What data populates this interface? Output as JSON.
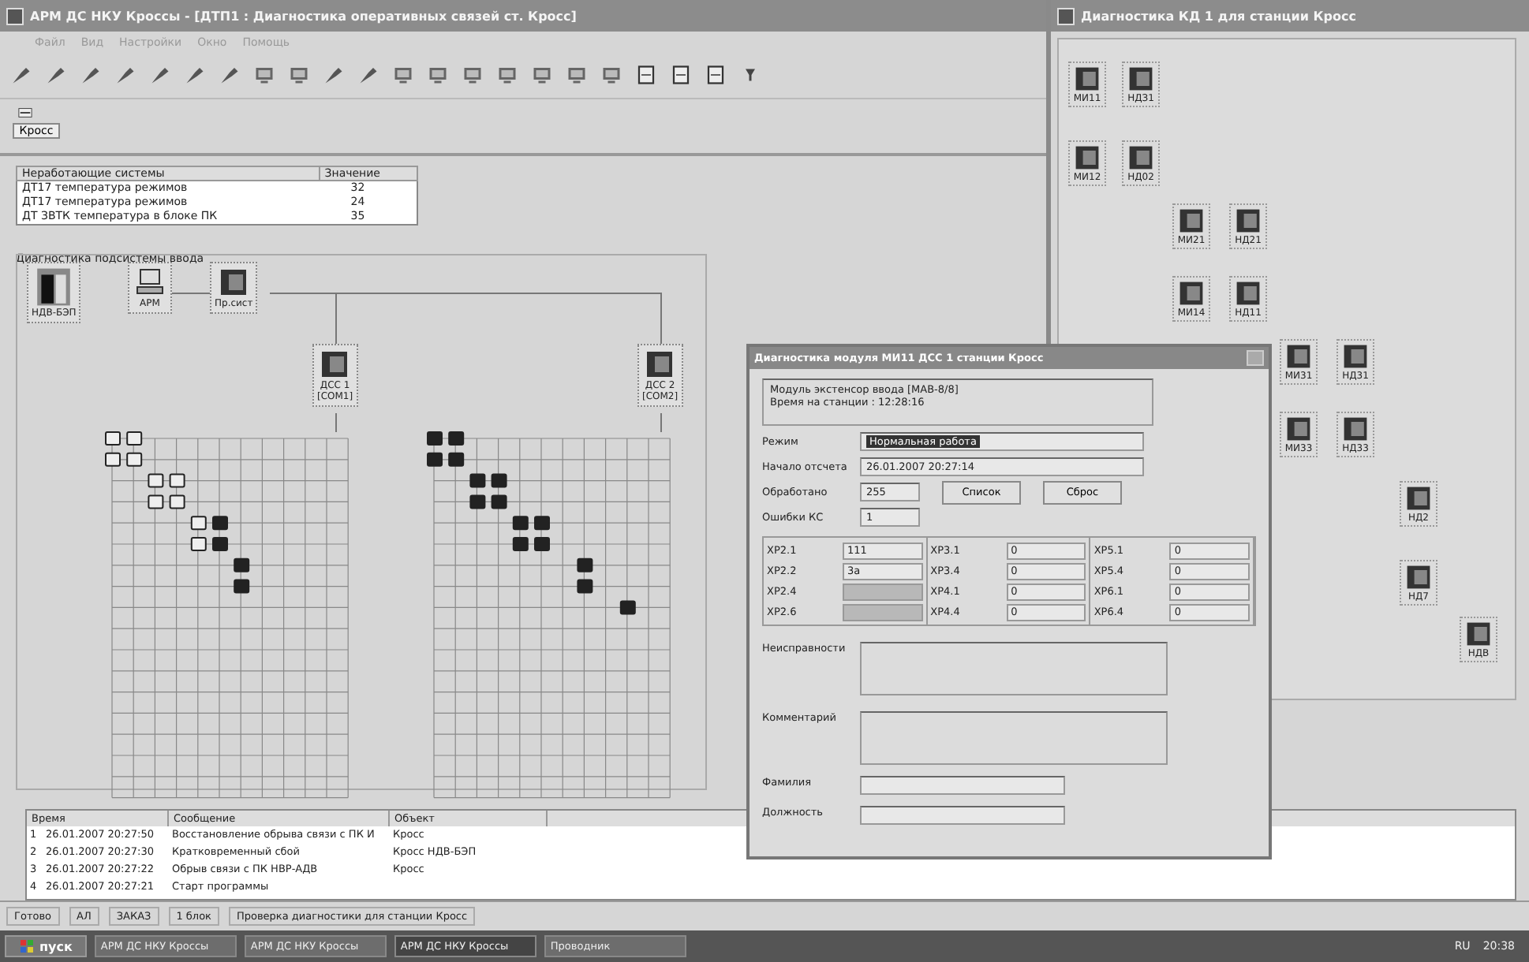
{
  "main_window": {
    "title": "АРМ ДС НКУ Кроссы - [ДТП1 : Диагностика оперативных связей ст. Кросс]"
  },
  "menu": [
    "Файл",
    "Вид",
    "Настройки",
    "Окно",
    "Помощь"
  ],
  "station_button": {
    "label": "Кросс"
  },
  "signals_table": {
    "columns": [
      "Неработающие системы",
      "Значение"
    ],
    "rows": [
      [
        "ДТ17 температура режимов",
        "32"
      ],
      [
        "ДТ17 температура режимов",
        "24"
      ],
      [
        "ДТ ЗВТК температура в блоке ПК",
        "35"
      ]
    ]
  },
  "diagram": {
    "title": "Диагностика подсистемы ввода",
    "nodes": [
      {
        "kind": "rack",
        "label": "НДВ-БЭП"
      },
      {
        "kind": "pc",
        "label": "АРМ"
      },
      {
        "kind": "module",
        "label": "Пр.сист"
      },
      {
        "kind": "module",
        "label": "ДСС 1",
        "port": "[COM1]"
      },
      {
        "kind": "module",
        "label": "ДСС 2",
        "port": "[COM2]"
      }
    ]
  },
  "right_window": {
    "title": "Диагностика КД 1 для станции Кросс",
    "modules": [
      "МИ11",
      "НДЗ1",
      "МИ12",
      "НД02",
      "МИ21",
      "НД21",
      "МИ14",
      "НД11",
      "МИ31",
      "НД31",
      "МИ33",
      "НД33",
      "НД2",
      "НД7",
      "НДВ"
    ]
  },
  "dialog": {
    "title": "Диагностика модуля МИ11 ДСС 1 станции Кросс",
    "info": [
      "Модуль экстенсор ввода [МАВ-8/8]",
      "Время на станции : 12:28:16"
    ],
    "mode": {
      "label": "Режим",
      "value": "Нормальная работа",
      "highlighted": true
    },
    "start": {
      "label": "Начало отсчета",
      "value": "26.01.2007 20:27:14"
    },
    "processed": {
      "label": "Обработано",
      "value": "255"
    },
    "errors": {
      "label": "Ошибки КС",
      "value": "1"
    },
    "buttons": [
      "Список",
      "Сброс"
    ],
    "ports": [
      [
        {
          "label": "ХР2.1",
          "value": "111",
          "disabled": false
        },
        {
          "label": "ХР2.2",
          "value": "3а",
          "disabled": false
        },
        {
          "label": "ХР2.4",
          "disabled": true
        },
        {
          "label": "ХР2.6",
          "disabled": true
        }
      ],
      [
        {
          "label": "ХР3.1",
          "value": "0",
          "disabled": false
        },
        {
          "label": "ХР3.4",
          "value": "0",
          "disabled": false
        },
        {
          "label": "ХР4.1",
          "value": "0",
          "disabled": false
        },
        {
          "label": "ХР4.4",
          "value": "0",
          "disabled": false
        }
      ],
      [
        {
          "label": "ХР5.1",
          "value": "0",
          "disabled": false
        },
        {
          "label": "ХР5.4",
          "value": "0",
          "disabled": false
        },
        {
          "label": "ХР6.1",
          "value": "0",
          "disabled": false
        },
        {
          "label": "ХР6.4",
          "value": "0",
          "disabled": false
        }
      ]
    ],
    "faults_label": "Неисправности",
    "comment_label": "Комментарий",
    "surname_label": "Фамилия",
    "position_label": "Должность"
  },
  "log": {
    "columns": [
      "Время",
      "Сообщение",
      "Объект"
    ],
    "rows": [
      {
        "number": "1",
        "time": "26.01.2007 20:27:50",
        "message": "Восстановление обрыва связи с ПК И",
        "object": "Кросс"
      },
      {
        "number": "2",
        "time": "26.01.2007 20:27:30",
        "message": "Кратковременный сбой",
        "object": "Кросс НДВ-БЭП"
      },
      {
        "number": "3",
        "time": "26.01.2007 20:27:22",
        "message": "Обрыв связи с ПК НВР-АДВ",
        "object": "Кросс"
      },
      {
        "number": "4",
        "time": "26.01.2007 20:27:21",
        "message": "Старт программы"
      }
    ]
  },
  "status_bar": [
    "Готово",
    "АЛ",
    "ЗАКАЗ",
    "1 блок",
    "Проверка диагностики для станции Кросс"
  ],
  "taskbar": {
    "start": "пуск",
    "tasks": [
      "АРМ ДС НКУ Кроссы",
      "АРМ ДС НКУ Кроссы",
      "АРМ ДС НКУ Кроссы",
      "Проводник"
    ],
    "tray": [
      "RU",
      "20:38"
    ]
  }
}
